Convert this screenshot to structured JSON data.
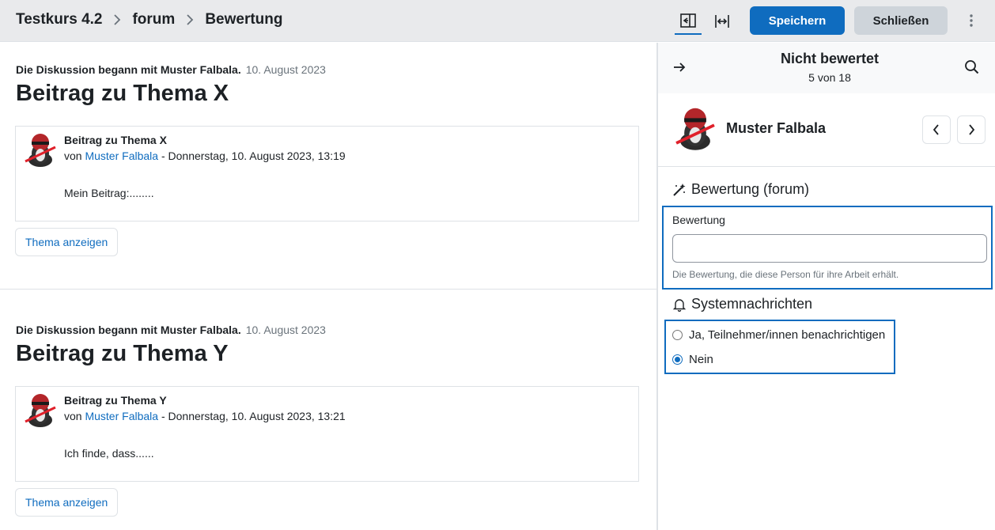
{
  "header": {
    "breadcrumbs": [
      "Testkurs 4.2",
      "forum",
      "Bewertung"
    ],
    "icons": [
      "collapse-panel-icon",
      "expand-horizontal-icon",
      "more-vertical-icon"
    ],
    "save_label": "Speichern",
    "close_label": "Schließen"
  },
  "discussions": [
    {
      "started_by": "Die Diskussion begann mit Muster Falbala.",
      "date": "10. August 2023",
      "title": "Beitrag zu Thema X",
      "post": {
        "subject": "Beitrag zu Thema X",
        "by_prefix": "von",
        "author": "Muster Falbala",
        "datetime": "- Donnerstag, 10. August 2023, 13:19",
        "body": "Mein Beitrag:........"
      },
      "view_label": "Thema anzeigen"
    },
    {
      "started_by": "Die Diskussion begann mit Muster Falbala.",
      "date": "10. August 2023",
      "title": "Beitrag zu Thema Y",
      "post": {
        "subject": "Beitrag zu Thema Y",
        "by_prefix": "von",
        "author": "Muster Falbala",
        "datetime": "- Donnerstag, 10. August 2023, 13:21",
        "body": "Ich finde, dass......"
      },
      "view_label": "Thema anzeigen"
    }
  ],
  "panel": {
    "status": "Nicht bewertet",
    "position": "5 von 18",
    "user_name": "Muster Falbala",
    "grading_heading": "Bewertung (forum)",
    "grade_label": "Bewertung",
    "grade_value": "",
    "grade_help": "Die Bewertung, die diese Person für ihre Arbeit erhält.",
    "notify_heading": "Systemnachrichten",
    "notify_options": [
      "Ja, Teilnehmer/innen benachrichtigen",
      "Nein"
    ],
    "notify_selected": "Nein"
  },
  "colors": {
    "accent": "#0f6cbf",
    "topbar": "#e9eaec"
  }
}
